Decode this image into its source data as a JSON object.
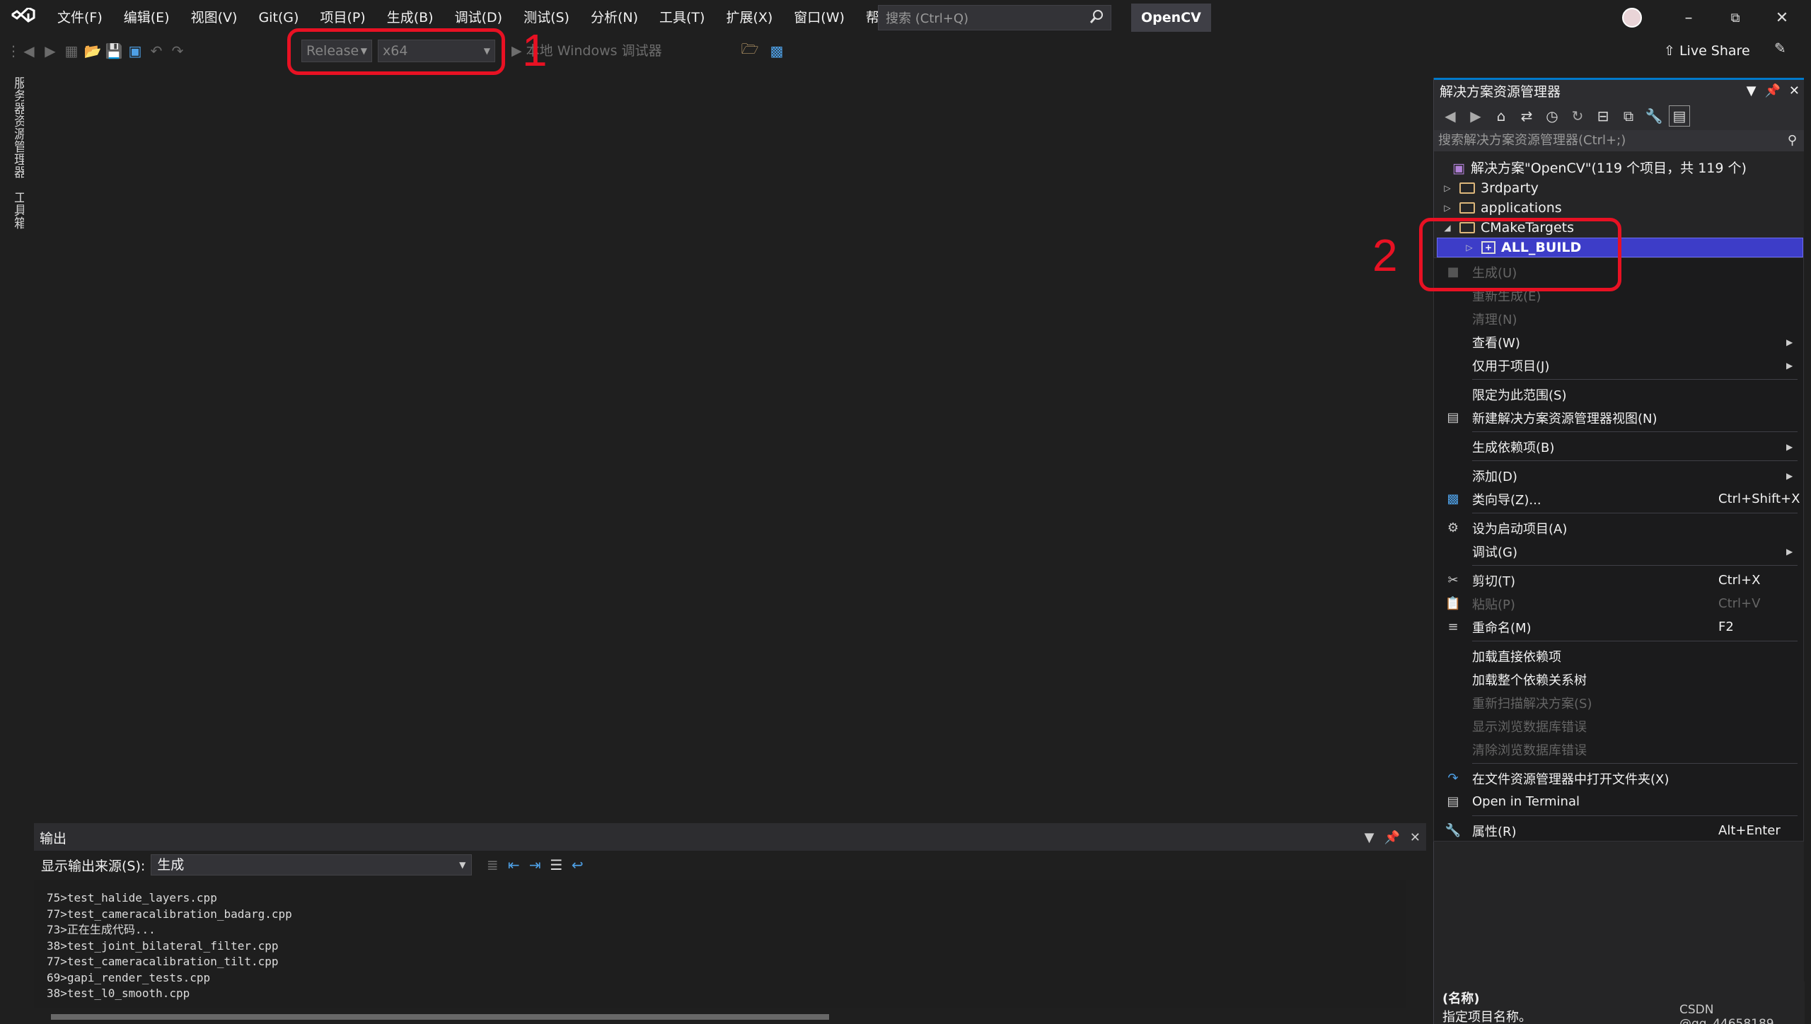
{
  "menubar": {
    "items": [
      "文件(F)",
      "编辑(E)",
      "视图(V)",
      "Git(G)",
      "项目(P)",
      "生成(B)",
      "调试(D)",
      "测试(S)",
      "分析(N)",
      "工具(T)",
      "扩展(X)",
      "窗口(W)",
      "帮助(H)"
    ],
    "search_placeholder": "搜索 (Ctrl+Q)",
    "solution_name": "OpenCV"
  },
  "toolbar": {
    "configuration": "Release",
    "platform": "x64",
    "debugger": "本地 Windows 调试器",
    "live_share": "Live Share"
  },
  "left_strip": {
    "tab1": "服务器资源管理器",
    "tab2": "工具箱"
  },
  "output": {
    "title": "输出",
    "source_label": "显示输出来源(S):",
    "source_value": "生成",
    "lines": [
      "75>test_halide_layers.cpp",
      "77>test_cameracalibration_badarg.cpp",
      "73>正在生成代码...",
      "38>test_joint_bilateral_filter.cpp",
      "77>test_cameracalibration_tilt.cpp",
      "69>gapi_render_tests.cpp",
      "38>test_l0_smooth.cpp"
    ]
  },
  "solution_explorer": {
    "title": "解决方案资源管理器",
    "search_placeholder": "搜索解决方案资源管理器(Ctrl+;)",
    "solution_node": "解决方案\"OpenCV\"(119 个项目，共 119 个)",
    "nodes": [
      "3rdparty",
      "applications",
      "CMakeTargets",
      "ALL_BUILD"
    ],
    "properties_name": "(名称)",
    "properties_desc": "指定项目名称。"
  },
  "context_menu": {
    "items": [
      {
        "label": "生成(U)",
        "shortcut": "",
        "disabled": true
      },
      {
        "label": "重新生成(E)",
        "shortcut": "",
        "disabled": true
      },
      {
        "label": "清理(N)",
        "shortcut": "",
        "disabled": true
      },
      {
        "label": "查看(W)",
        "shortcut": "",
        "submenu": true
      },
      {
        "label": "仅用于项目(J)",
        "shortcut": "",
        "submenu": true
      },
      {
        "label": "限定为此范围(S)",
        "shortcut": ""
      },
      {
        "label": "新建解决方案资源管理器视图(N)",
        "shortcut": ""
      },
      {
        "label": "生成依赖项(B)",
        "shortcut": "",
        "submenu": true
      },
      {
        "label": "添加(D)",
        "shortcut": "",
        "submenu": true
      },
      {
        "label": "类向导(Z)...",
        "shortcut": "Ctrl+Shift+X"
      },
      {
        "label": "设为启动项目(A)",
        "shortcut": ""
      },
      {
        "label": "调试(G)",
        "shortcut": "",
        "submenu": true
      },
      {
        "label": "剪切(T)",
        "shortcut": "Ctrl+X"
      },
      {
        "label": "粘贴(P)",
        "shortcut": "Ctrl+V",
        "disabled": true
      },
      {
        "label": "重命名(M)",
        "shortcut": "F2"
      },
      {
        "label": "加载直接依赖项",
        "shortcut": ""
      },
      {
        "label": "加载整个依赖关系树",
        "shortcut": ""
      },
      {
        "label": "重新扫描解决方案(S)",
        "shortcut": "",
        "disabled": true
      },
      {
        "label": "显示浏览数据库错误",
        "shortcut": "",
        "disabled": true
      },
      {
        "label": "清除浏览数据库错误",
        "shortcut": "",
        "disabled": true
      },
      {
        "label": "在文件资源管理器中打开文件夹(X)",
        "shortcut": ""
      },
      {
        "label": "Open in Terminal",
        "shortcut": ""
      },
      {
        "label": "属性(R)",
        "shortcut": "Alt+Enter"
      }
    ]
  },
  "annotations": {
    "one": "1",
    "two": "2",
    "color": "#e81123"
  },
  "watermark": "CSDN @qq_44658189"
}
